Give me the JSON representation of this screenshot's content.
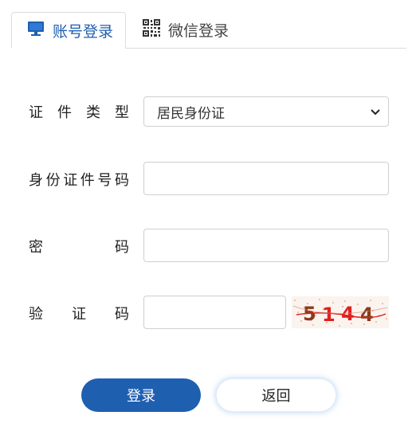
{
  "tabs": {
    "account_label": "账号登录",
    "wechat_label": "微信登录"
  },
  "form": {
    "id_type": {
      "label_chars": [
        "证",
        "件",
        "类",
        "型"
      ],
      "selected": "居民身份证"
    },
    "id_number": {
      "label_chars": [
        "身",
        "份",
        "证",
        "件",
        "号",
        "码"
      ],
      "value": ""
    },
    "password": {
      "label_chars": [
        "密",
        "码"
      ],
      "value": ""
    },
    "captcha": {
      "label_chars": [
        "验",
        "证",
        "码"
      ],
      "value": "",
      "image_text": "5144"
    }
  },
  "buttons": {
    "login": "登录",
    "back": "返回"
  },
  "colors": {
    "accent": "#1f5fb0",
    "border": "#cfcfcf",
    "captcha_red": "#e02020",
    "captcha_brown": "#8a3a1a"
  },
  "icons": {
    "account_tab": "monitor-icon",
    "wechat_tab": "qr-code-icon",
    "select": "chevron-down-icon"
  }
}
